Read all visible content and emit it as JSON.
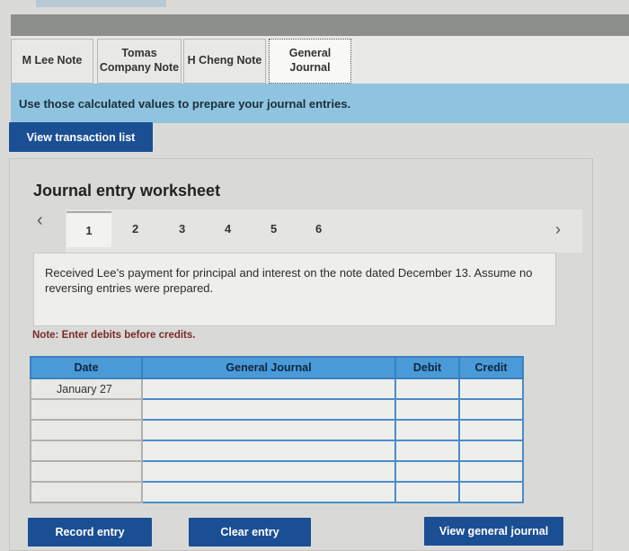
{
  "tabs": [
    {
      "label": "M Lee Note"
    },
    {
      "label_line1": "Tomas",
      "label_line2": "Company Note"
    },
    {
      "label": "H Cheng Note"
    },
    {
      "label_line1": "General",
      "label_line2": "Journal",
      "active": true
    }
  ],
  "instruction": "Use those calculated values to prepare your journal entries.",
  "view_transaction_list": "View transaction list",
  "worksheet": {
    "title": "Journal entry worksheet",
    "pages": [
      "1",
      "2",
      "3",
      "4",
      "5",
      "6"
    ],
    "active_page": "1",
    "prev_icon": "chevron-left",
    "next_icon": "chevron-right",
    "description": "Received Lee’s payment for principal and interest on the note dated December 13. Assume no reversing entries were prepared.",
    "note": "Note: Enter debits before credits."
  },
  "journal_table": {
    "headers": {
      "date": "Date",
      "account": "General Journal",
      "debit": "Debit",
      "credit": "Credit"
    },
    "rows": [
      {
        "date": "January 27",
        "account": "",
        "debit": "",
        "credit": ""
      },
      {
        "date": "",
        "account": "",
        "debit": "",
        "credit": ""
      },
      {
        "date": "",
        "account": "",
        "debit": "",
        "credit": ""
      },
      {
        "date": "",
        "account": "",
        "debit": "",
        "credit": ""
      },
      {
        "date": "",
        "account": "",
        "debit": "",
        "credit": ""
      },
      {
        "date": "",
        "account": "",
        "debit": "",
        "credit": ""
      }
    ]
  },
  "buttons": {
    "record_entry": "Record entry",
    "clear_entry": "Clear entry",
    "view_general_journal": "View general journal"
  },
  "colors": {
    "primary_button": "#1b4f94",
    "instruction_bar": "#8ec4e0",
    "table_header": "#4a9ad8"
  }
}
